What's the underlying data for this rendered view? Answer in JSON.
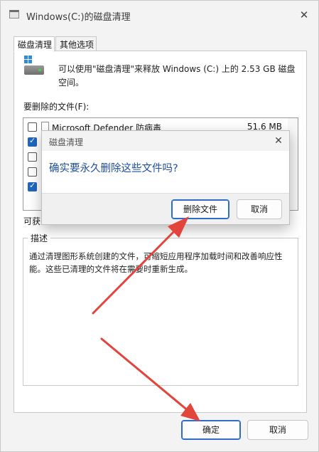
{
  "window": {
    "title": "Windows(C:)的磁盘清理",
    "close_glyph": "✕"
  },
  "tabs": [
    {
      "label": "磁盘清理",
      "active": true
    },
    {
      "label": "其他选项",
      "active": false
    }
  ],
  "intro": {
    "text": "可以使用\"磁盘清理\"来释放 Windows (C:) 上的 2.53 GB 磁盘空间。"
  },
  "files": {
    "label": "要删除的文件(F):",
    "rows": [
      {
        "checked": false,
        "name": "Microsoft Defender 防病毒",
        "size": "51.6 MB"
      },
      {
        "checked": true,
        "name": "",
        "size": ""
      },
      {
        "checked": false,
        "name": "",
        "size": ""
      },
      {
        "checked": false,
        "name": "",
        "size": ""
      },
      {
        "checked": true,
        "name": "",
        "size": ""
      }
    ]
  },
  "available": {
    "label": "可获"
  },
  "description": {
    "title": "描述",
    "text": "通过清理图形系统创建的文件，可缩短应用程序加载时间和改善响应性能。这些已清理的文件将在需要时重新生成。"
  },
  "buttons": {
    "ok": "确定",
    "cancel": "取消"
  },
  "dialog": {
    "title": "磁盘清理",
    "close_glyph": "✕",
    "question": "确实要永久删除这些文件吗?",
    "delete_button": "删除文件",
    "cancel_button": "取消"
  },
  "colors": {
    "accent": "#1f66c1",
    "question_text": "#1f4fa3",
    "annotation_arrow": "#e2453c"
  }
}
